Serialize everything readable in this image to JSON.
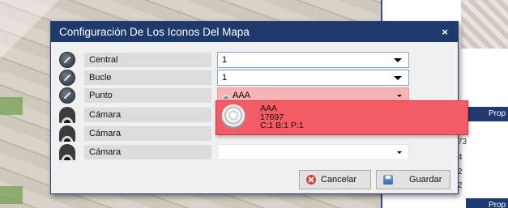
{
  "dialog": {
    "title": "Configuración De Los Iconos Del Mapa",
    "close_label": "×"
  },
  "rows": [
    {
      "icon": "edit-circle-icon",
      "label": "Central",
      "value": "1"
    },
    {
      "icon": "edit-circle-icon",
      "label": "Bucle",
      "value": "1"
    },
    {
      "icon": "edit-circle-icon",
      "label": "Punto",
      "value": "AAA"
    },
    {
      "icon": "camera-icon",
      "label": "Cámara",
      "value": ""
    },
    {
      "icon": "camera-icon",
      "label": "Cámara",
      "value": ""
    },
    {
      "icon": "camera-icon",
      "label": "Cámara",
      "value": ""
    }
  ],
  "punto_dropdown": {
    "option_name": "AAA",
    "option_id": "17697",
    "option_address": "C:1 B:1 P:1",
    "icon": "smoke-detector-icon"
  },
  "buttons": {
    "cancel": "Cancelar",
    "save": "Guardar"
  },
  "background": {
    "prop_label_1": "Prop",
    "prop_label_2": "Prop",
    "side_values": [
      "73",
      "4",
      "2",
      "2"
    ]
  },
  "colors": {
    "titlebar": "#1e3a6c",
    "selected_option": "#f45b64",
    "punto_field": "#f8b3b4"
  }
}
